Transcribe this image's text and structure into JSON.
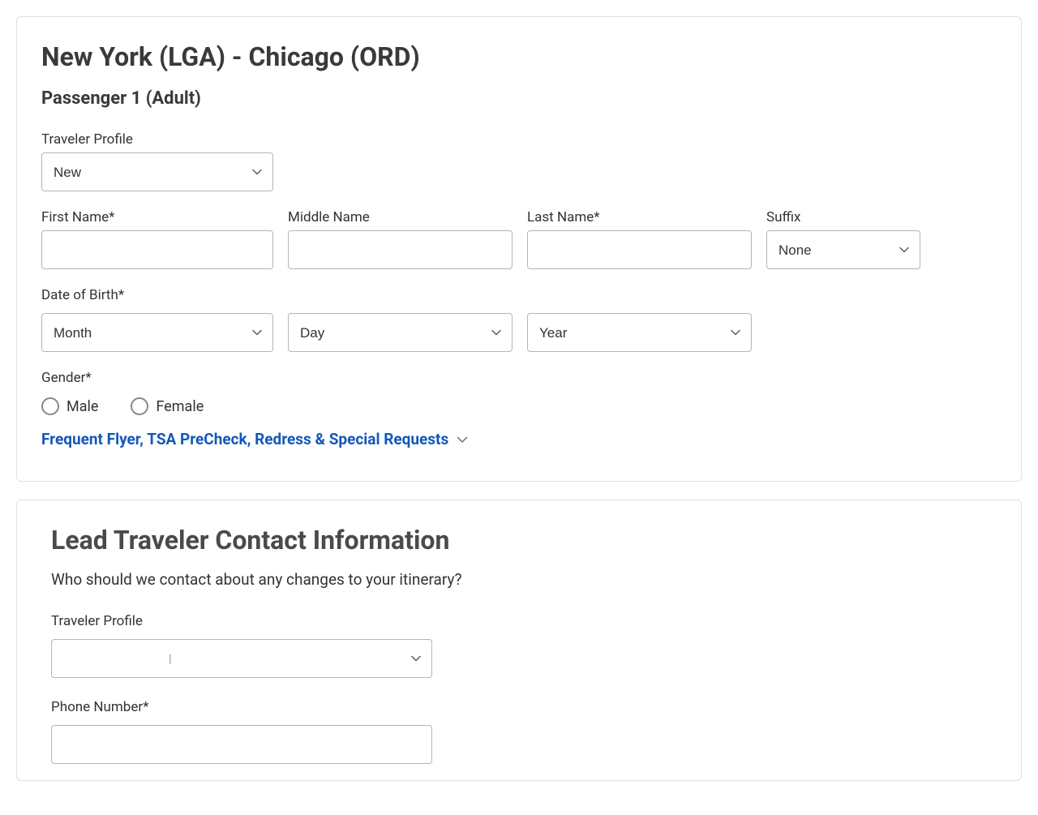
{
  "section1": {
    "title": "New York (LGA) - Chicago (ORD)",
    "passengerHeader": "Passenger 1 (Adult)",
    "travelerProfileLabel": "Traveler Profile",
    "travelerProfileValue": "New",
    "firstNameLabel": "First Name*",
    "middleNameLabel": "Middle Name",
    "lastNameLabel": "Last Name*",
    "suffixLabel": "Suffix",
    "suffixValue": "None",
    "dobLabel": "Date of Birth*",
    "monthValue": "Month",
    "dayValue": "Day",
    "yearValue": "Year",
    "genderLabel": "Gender*",
    "maleLabel": "Male",
    "femaleLabel": "Female",
    "expandLinkText": "Frequent Flyer, TSA PreCheck, Redress & Special Requests"
  },
  "section2": {
    "title": "Lead Traveler Contact Information",
    "subtitle": "Who should we contact about any changes to your itinerary?",
    "travelerProfileLabel": "Traveler Profile",
    "travelerProfileValue": "",
    "phoneLabel": "Phone Number*"
  }
}
